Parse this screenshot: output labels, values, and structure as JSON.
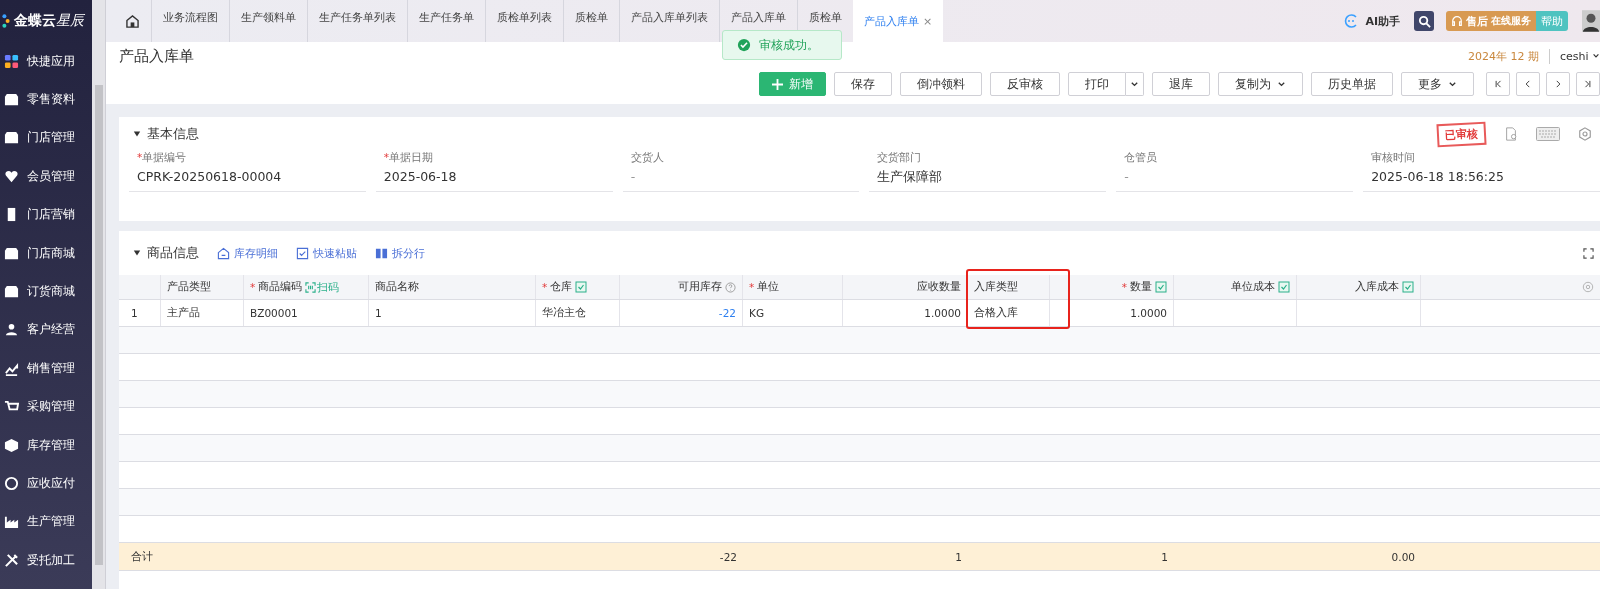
{
  "sidebar": {
    "logo": "金蝶云",
    "logo_accent": "星辰",
    "items": [
      {
        "label": "快捷应用"
      },
      {
        "label": "零售资料"
      },
      {
        "label": "门店管理"
      },
      {
        "label": "会员管理"
      },
      {
        "label": "门店营销"
      },
      {
        "label": "门店商城"
      },
      {
        "label": "订货商城"
      },
      {
        "label": "客户经营"
      },
      {
        "label": "销售管理"
      },
      {
        "label": "采购管理"
      },
      {
        "label": "库存管理"
      },
      {
        "label": "应收应付"
      },
      {
        "label": "生产管理"
      },
      {
        "label": "受托加工"
      }
    ]
  },
  "tabs": [
    {
      "label": "业务流程图",
      "selected": false
    },
    {
      "label": "生产领料单",
      "selected": false
    },
    {
      "label": "生产任务单列表",
      "selected": false
    },
    {
      "label": "生产任务单",
      "selected": false
    },
    {
      "label": "质检单列表",
      "selected": false
    },
    {
      "label": "质检单",
      "selected": false
    },
    {
      "label": "产品入库单列表",
      "selected": false
    },
    {
      "label": "产品入库单",
      "selected": false
    },
    {
      "label": "质检单",
      "selected": false
    },
    {
      "label": "产品入库单",
      "selected": true,
      "close": "×"
    }
  ],
  "header": {
    "ai": "AI助手",
    "service": "售后",
    "service_sub": "在线服务",
    "help": "帮助",
    "period": "2024年 12 期",
    "user": "ceshi"
  },
  "toast": {
    "text": "审核成功。"
  },
  "page_title": "产品入库单",
  "toolbar": [
    {
      "label": "新增",
      "kind": "primary"
    },
    {
      "label": "保存",
      "kind": "plain"
    },
    {
      "label": "倒冲领料",
      "kind": "plain"
    },
    {
      "label": "反审核",
      "kind": "plain"
    },
    {
      "label": "打印",
      "kind": "split"
    },
    {
      "label": "退库",
      "kind": "plain"
    },
    {
      "label": "复制为",
      "kind": "dropdown"
    },
    {
      "label": "历史单据",
      "kind": "plain"
    },
    {
      "label": "更多",
      "kind": "dropdown"
    }
  ],
  "nav_buttons": [
    {
      "kind": "first"
    },
    {
      "kind": "prev"
    },
    {
      "kind": "next"
    },
    {
      "kind": "last"
    }
  ],
  "required_mark": "*",
  "basic": {
    "title": "基本信息",
    "status": "已审核",
    "fields": [
      {
        "label": "单据编号",
        "value": "CPRK-20250618-00004",
        "required": true
      },
      {
        "label": "单据日期",
        "value": "2025-06-18",
        "required": true
      },
      {
        "label": "交货人",
        "placeholder": "-",
        "required": false
      },
      {
        "label": "交货部门",
        "value": "生产保障部",
        "required": false
      },
      {
        "label": "仓管员",
        "placeholder": "-",
        "required": false
      },
      {
        "label": "审核时间",
        "value": "2025-06-18 18:56:25",
        "required": false
      }
    ]
  },
  "goods": {
    "title": "商品信息",
    "actions": [
      {
        "label": "库存明细",
        "kind": "house"
      },
      {
        "label": "快速粘贴",
        "kind": "check"
      },
      {
        "label": "拆分行",
        "kind": "split"
      }
    ],
    "columns": [
      {
        "label": "产品类型",
        "required": false,
        "batch": false,
        "numeric": false,
        "help": false,
        "linked": false,
        "highlighted": false
      },
      {
        "label": "商品编码",
        "required": true,
        "batch": false,
        "numeric": false,
        "help": false,
        "linked": false,
        "highlighted": false,
        "scan": "扫码"
      },
      {
        "label": "商品名称",
        "required": false,
        "batch": false,
        "numeric": false,
        "help": false,
        "linked": false,
        "highlighted": false
      },
      {
        "label": "仓库",
        "required": true,
        "batch": true,
        "numeric": false,
        "help": false,
        "linked": false,
        "highlighted": false
      },
      {
        "label": "可用库存",
        "required": false,
        "batch": false,
        "numeric": true,
        "help": true,
        "linked": true,
        "highlighted": false,
        "total": "-22"
      },
      {
        "label": "单位",
        "required": true,
        "batch": false,
        "numeric": false,
        "help": false,
        "linked": false,
        "highlighted": false
      },
      {
        "label": "应收数量",
        "required": false,
        "batch": false,
        "numeric": true,
        "help": false,
        "linked": false,
        "highlighted": false,
        "total": "1"
      },
      {
        "label": "入库类型",
        "required": false,
        "batch": false,
        "numeric": false,
        "help": false,
        "linked": false,
        "highlighted": true
      },
      {
        "label": "数量",
        "required": true,
        "batch": true,
        "numeric": true,
        "help": false,
        "linked": false,
        "highlighted": false,
        "total": "1"
      },
      {
        "label": "单位成本",
        "required": false,
        "batch": true,
        "numeric": true,
        "help": false,
        "linked": false,
        "highlighted": false
      },
      {
        "label": "入库成本",
        "required": false,
        "batch": true,
        "numeric": true,
        "help": false,
        "linked": false,
        "highlighted": false,
        "total": "0.00"
      }
    ],
    "rows": [
      {
        "number": "1",
        "cells": [
          "主产品",
          "BZ00001",
          "1",
          "华冶主仓",
          "-22",
          "KG",
          "1.0000",
          "合格入库",
          "1.0000"
        ]
      }
    ],
    "total_label": "合计"
  }
}
